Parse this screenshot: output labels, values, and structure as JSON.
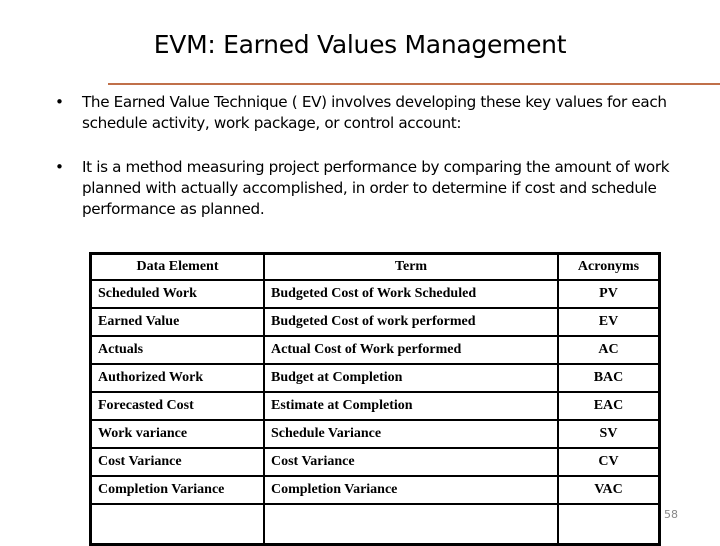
{
  "slide": {
    "title": "EVM: Earned Values Management",
    "bullets": [
      {
        "marker": "•",
        "text": "The Earned Value Technique ( EV) involves developing these key values for each schedule activity, work package, or control account:"
      },
      {
        "marker": "•",
        "text": "It is a method measuring project performance by comparing the amount of work planned with actually accomplished, in order to determine if cost and schedule performance as planned."
      }
    ],
    "table": {
      "headers": [
        "Data Element",
        "Term",
        "Acronyms"
      ],
      "rows": [
        [
          "Scheduled Work",
          "Budgeted Cost of Work Scheduled",
          "PV"
        ],
        [
          "Earned Value",
          "Budgeted Cost of work performed",
          "EV"
        ],
        [
          "Actuals",
          "Actual Cost of Work performed",
          "AC"
        ],
        [
          "Authorized Work",
          "Budget at Completion",
          "BAC"
        ],
        [
          "Forecasted Cost",
          "Estimate at Completion",
          "EAC"
        ],
        [
          "Work variance",
          "Schedule Variance",
          "SV"
        ],
        [
          "Cost Variance",
          "Cost Variance",
          "CV"
        ],
        [
          "Completion Variance",
          "Completion Variance",
          "VAC"
        ],
        [
          "",
          "",
          ""
        ]
      ]
    },
    "page_number": "58",
    "colors": {
      "title_rule": "#c0704a",
      "page_number": "#888888"
    }
  }
}
